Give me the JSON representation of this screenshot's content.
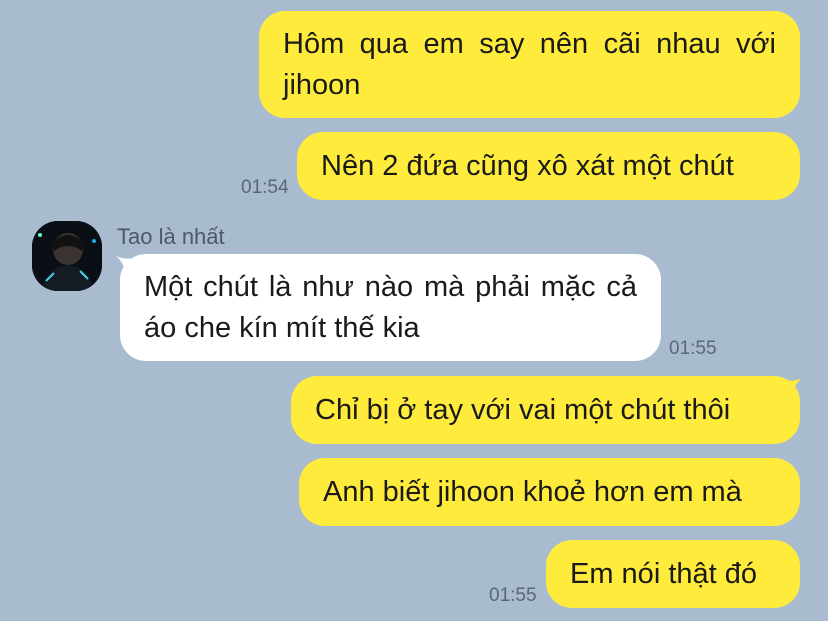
{
  "colors": {
    "background": "#a9bccf",
    "my_bubble": "#ffeb3b",
    "their_bubble": "#ffffff",
    "timestamp": "#586878"
  },
  "messages": [
    {
      "from": "me",
      "text": "Hôm qua em say nên cãi nhau với jihoon"
    },
    {
      "from": "me",
      "text": "Nên 2 đứa cũng xô xát một chút",
      "time": "01:54"
    },
    {
      "from": "Tao là nhất",
      "avatar": "profile-photo",
      "text": "Một chút là như nào mà phải mặc cả áo che kín mít thế kia",
      "time": "01:55"
    },
    {
      "from": "me",
      "text": "Chỉ bị ở tay với vai một chút thôi"
    },
    {
      "from": "me",
      "text": "Anh biết jihoon khoẻ hơn em mà"
    },
    {
      "from": "me",
      "text": "Em nói thật đó",
      "time": "01:55"
    }
  ],
  "contact": {
    "name": "Tao là nhất"
  }
}
